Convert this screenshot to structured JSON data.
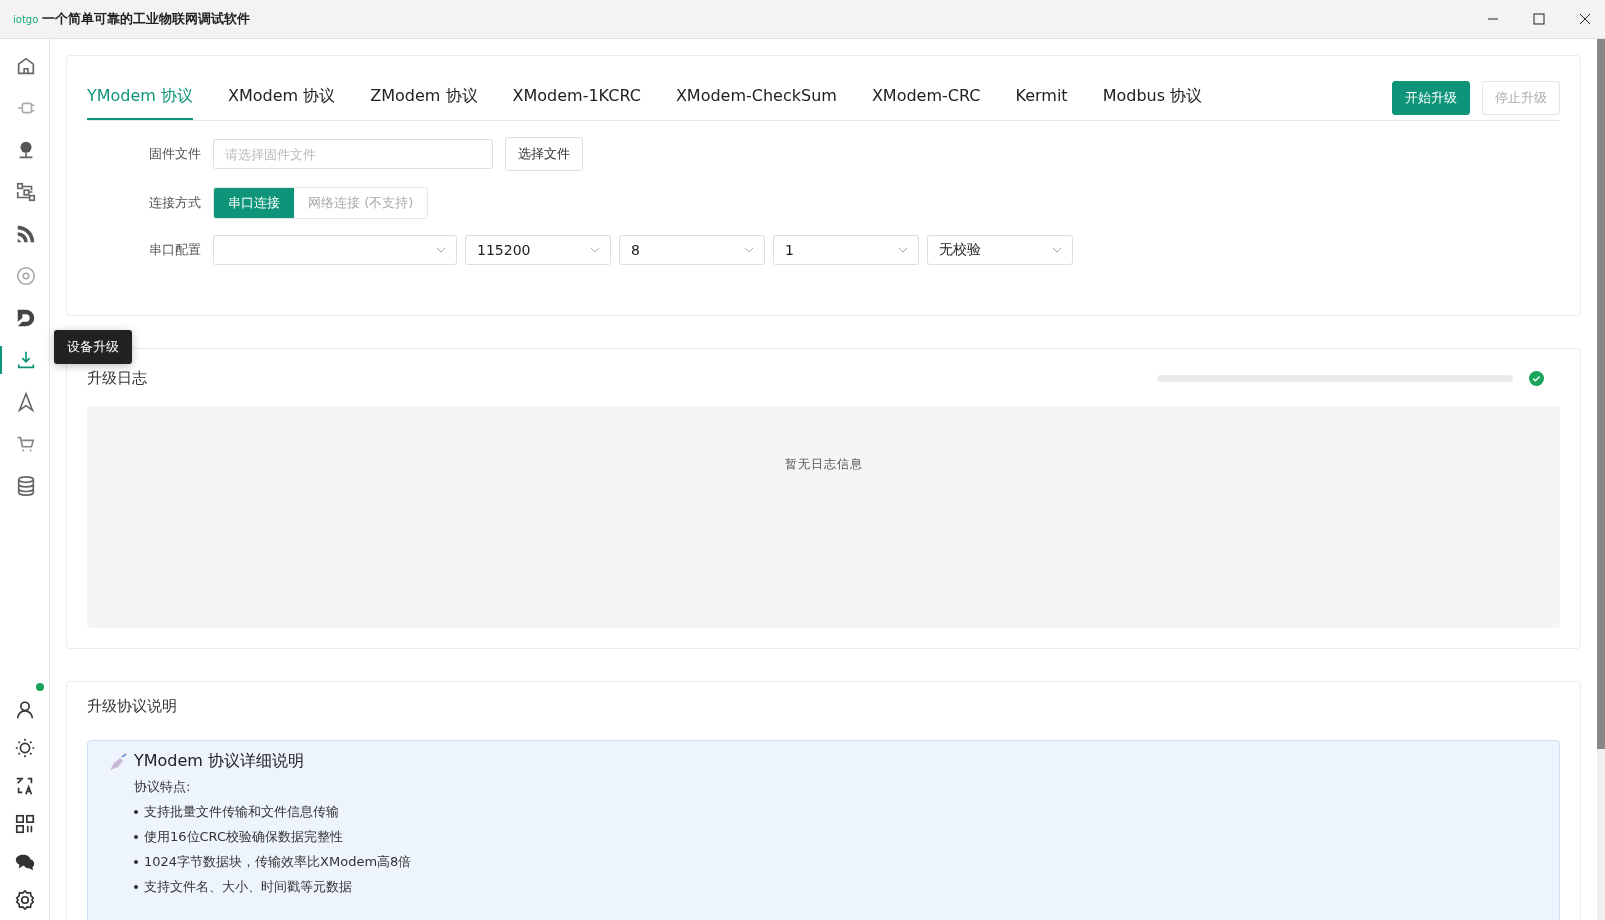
{
  "window": {
    "logo": "iotgo",
    "title": "一个简单可靠的工业物联网调试软件"
  },
  "sidebar": {
    "items": [
      {
        "kind": "home",
        "selected": false
      },
      {
        "kind": "plug",
        "selected": false
      },
      {
        "kind": "globe",
        "selected": false
      },
      {
        "kind": "flow",
        "selected": false
      },
      {
        "kind": "rss",
        "selected": false
      },
      {
        "kind": "target",
        "selected": false
      },
      {
        "kind": "d",
        "selected": false
      },
      {
        "kind": "download",
        "selected": true,
        "tooltip": "设备升级"
      },
      {
        "kind": "send",
        "selected": false
      },
      {
        "kind": "cart",
        "selected": false
      },
      {
        "kind": "database",
        "selected": false
      }
    ],
    "bottom": [
      {
        "kind": "user",
        "online": true
      },
      {
        "kind": "sun"
      },
      {
        "kind": "translate"
      },
      {
        "kind": "apps"
      },
      {
        "kind": "chat"
      },
      {
        "kind": "settings"
      }
    ]
  },
  "tabs": [
    {
      "label": "YModem 协议",
      "selected": true
    },
    {
      "label": "XModem 协议",
      "selected": false
    },
    {
      "label": "ZModem 协议",
      "selected": false
    },
    {
      "label": "XModem-1KCRC",
      "selected": false
    },
    {
      "label": "XModem-CheckSum",
      "selected": false
    },
    {
      "label": "XModem-CRC",
      "selected": false
    },
    {
      "label": "Kermit",
      "selected": false
    },
    {
      "label": "Modbus 协议",
      "selected": false
    }
  ],
  "actions": [
    {
      "label": "开始升级",
      "disabled": false
    },
    {
      "label": "停止升级",
      "disabled": true
    }
  ],
  "form": {
    "file_label": "固件文件",
    "file_placeholder": "请选择固件文件",
    "file_button": "选择文件",
    "conn_label": "连接方式",
    "conn_options": [
      {
        "label": "串口连接",
        "selected": true,
        "disabled": false
      },
      {
        "label": "网络连接 (不支持)",
        "selected": false,
        "disabled": true
      }
    ],
    "serial_label": "串口配置",
    "selects": [
      {
        "wide": true
      },
      {
        "value": "115200"
      },
      {
        "value": "8"
      },
      {
        "value": "1"
      },
      {
        "value": "无校验"
      }
    ]
  },
  "log": {
    "title": "升级日志",
    "level": 0,
    "empty": "暂无日志信息"
  },
  "info": {
    "title": "升级协议说明",
    "heading": "YModem 协议详细说明",
    "subtitle": "协议特点:",
    "bullets": [
      "支持批量文件传输和文件信息传输",
      "使用16位CRC校验确保数据完整性",
      "1024字节数据块，传输效率比XModem高8倍",
      "支持文件名、大小、时间戳等元数据"
    ]
  }
}
